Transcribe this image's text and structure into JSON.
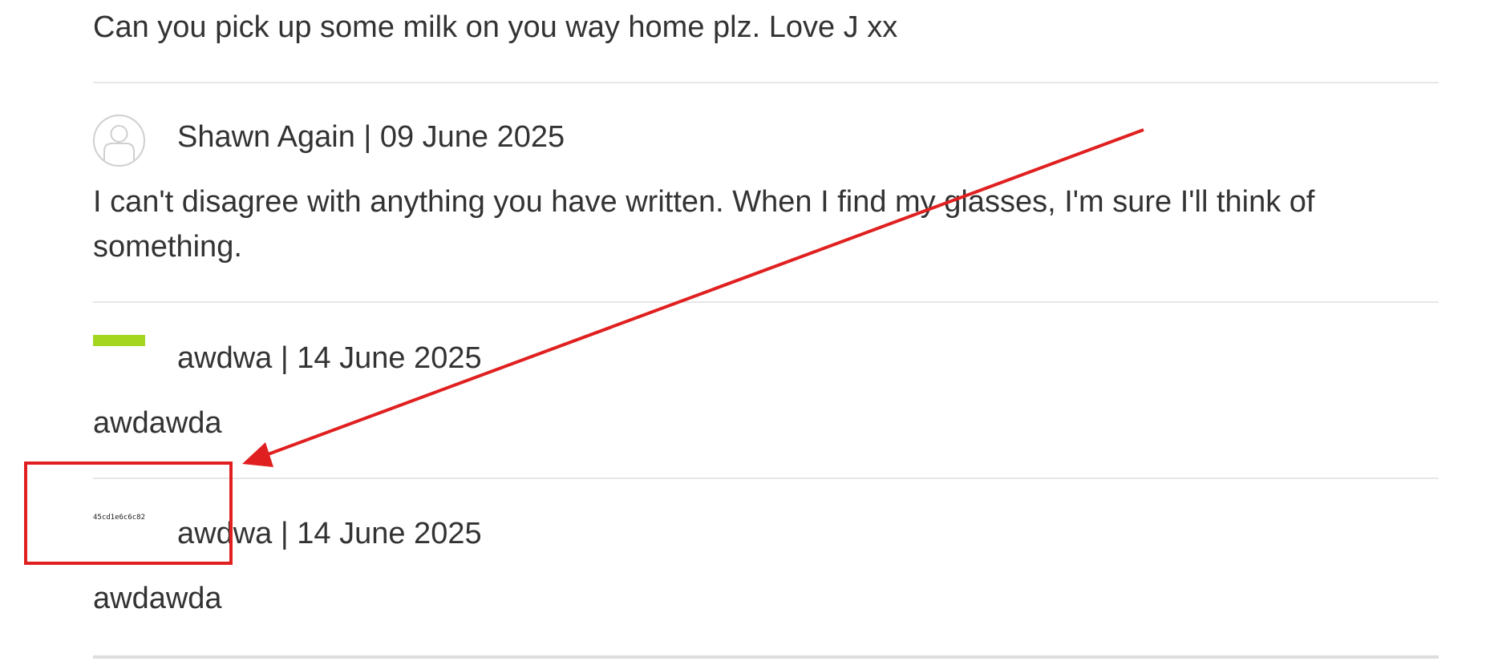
{
  "previous_comment": {
    "text": "Can you pick up some milk on you way home plz. Love J xx"
  },
  "comments": [
    {
      "author_date": "Shawn Again | 09 June 2025",
      "text": "I can't disagree with anything you have written. When I find my glasses, I'm sure I'll think of something.",
      "avatar": "default-user-icon"
    },
    {
      "author_date": "awdwa | 14 June 2025",
      "text": "awdawda",
      "avatar": "broken-image-avatar"
    },
    {
      "author_date": "awdwa | 14 June 2025",
      "text": "awdawda",
      "avatar": "hash-avatar",
      "avatar_text": "45cd1e6c6c82"
    }
  ],
  "annotation": {
    "color": "#e02020",
    "target": "comment-avatar-3"
  },
  "colors": {
    "text": "#333333",
    "divider": "#e7e7e7",
    "avatar_accent": "#a5d61f"
  }
}
